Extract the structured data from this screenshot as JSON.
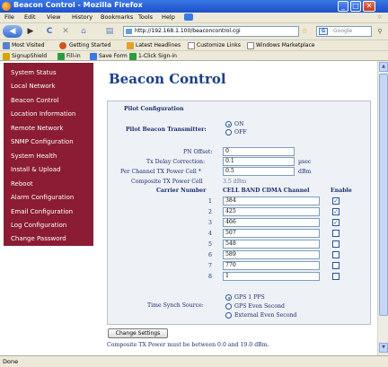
{
  "window": {
    "title": "Beacon Control - Mozilla Firefox",
    "minimize": "_",
    "maximize": "□",
    "close": "✕"
  },
  "menu": [
    "File",
    "Edit",
    "View",
    "History",
    "Bookmarks",
    "Tools",
    "Help"
  ],
  "nav": {
    "back": "◀",
    "forward": "▶",
    "reload": "C",
    "stop": "✕",
    "home": "⌂",
    "url": "http://192.168.1.100/beaconcontrol.cgi",
    "search_placeholder": "Google"
  },
  "bookmarks": [
    "Most Visited",
    "Getting Started",
    "Latest Headlines",
    "Customize Links",
    "Windows Marketplace"
  ],
  "addons": [
    "SignupShield",
    "Fill-in",
    "Save Form",
    "1-Click Sign-in"
  ],
  "sidebar": {
    "items": [
      "System Status",
      "Local Network",
      "Beacon Control",
      "Location Information",
      "Remote Network",
      "SNMP Configuration",
      "System Health",
      "Install & Upload",
      "Reboot",
      "Alarm Configuration",
      "Email Configuration",
      "Log Configuration",
      "Change Password"
    ]
  },
  "page": {
    "title": "Beacon Control",
    "section": "Pilot Configuration",
    "transmitter_label": "Pilot Beacon Transmitter:",
    "on_label": "ON",
    "off_label": "OFF",
    "pn_label": "PN Offset:",
    "pn_value": "0",
    "delay_label": "Tx Delay Correction:",
    "delay_value": "0.1",
    "delay_unit": "µsec",
    "power_label": "Per Channel TX Power Cell *",
    "power_value": "0.5",
    "power_unit": "dBm",
    "composite_label": "Composite TX Power Cell",
    "composite_value": "3.5 dBm",
    "col_carrier": "Carrier Number",
    "col_channel": "CELL BAND CDMA Channel",
    "col_enable": "Enable",
    "carriers": [
      {
        "num": "1",
        "channel": "384",
        "enabled": true
      },
      {
        "num": "2",
        "channel": "425",
        "enabled": true
      },
      {
        "num": "3",
        "channel": "466",
        "enabled": true
      },
      {
        "num": "4",
        "channel": "507",
        "enabled": false
      },
      {
        "num": "5",
        "channel": "548",
        "enabled": false
      },
      {
        "num": "6",
        "channel": "589",
        "enabled": false
      },
      {
        "num": "7",
        "channel": "770",
        "enabled": false
      },
      {
        "num": "8",
        "channel": "1",
        "enabled": false
      }
    ],
    "sync_label": "Time Synch Source:",
    "sync_options": [
      "GPS 1 PPS",
      "GPS Even Second",
      "External Even Second"
    ],
    "sync_selected": 0,
    "button_label": "Change Settings",
    "note": "Composite TX Power must be between 0.0 and 19.0 dBm."
  },
  "status": "Done",
  "colors": {
    "sidebar": "#8b1c33",
    "title": "#1a3e8a",
    "panel": "#eef1f6",
    "check": "#1d8a2c"
  }
}
